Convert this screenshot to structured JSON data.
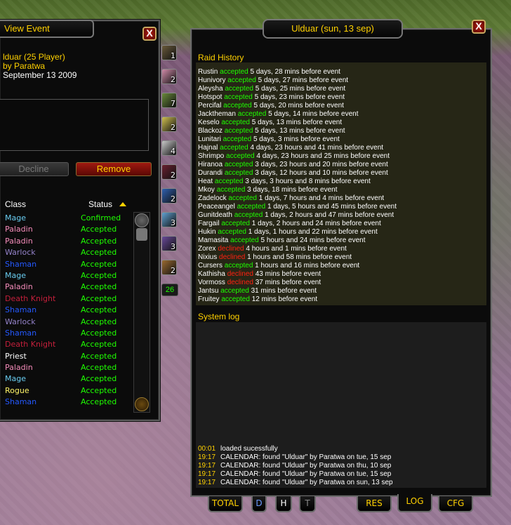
{
  "left": {
    "title": "View Event",
    "event_name": "lduar (25 Player)",
    "created_by": "by Paratwa",
    "date": "September 13 2009",
    "decline_label": "Decline",
    "remove_label": "Remove",
    "col_class": "Class",
    "col_status": "Status",
    "close_label": "X",
    "roster": [
      {
        "class": "Mage",
        "color": "#69ccf0",
        "status": "Confirmed"
      },
      {
        "class": "Paladin",
        "color": "#f58cba",
        "status": "Accepted"
      },
      {
        "class": "Paladin",
        "color": "#f58cba",
        "status": "Accepted"
      },
      {
        "class": "Warlock",
        "color": "#9482c9",
        "status": "Accepted"
      },
      {
        "class": "Shaman",
        "color": "#2459ff",
        "status": "Accepted"
      },
      {
        "class": "Mage",
        "color": "#69ccf0",
        "status": "Accepted"
      },
      {
        "class": "Paladin",
        "color": "#f58cba",
        "status": "Accepted"
      },
      {
        "class": "Death Knight",
        "color": "#c41f3b",
        "status": "Accepted"
      },
      {
        "class": "Shaman",
        "color": "#2459ff",
        "status": "Accepted"
      },
      {
        "class": "Warlock",
        "color": "#9482c9",
        "status": "Accepted"
      },
      {
        "class": "Shaman",
        "color": "#2459ff",
        "status": "Accepted"
      },
      {
        "class": "Death Knight",
        "color": "#c41f3b",
        "status": "Accepted"
      },
      {
        "class": "Priest",
        "color": "#ffffff",
        "status": "Accepted"
      },
      {
        "class": "Paladin",
        "color": "#f58cba",
        "status": "Accepted"
      },
      {
        "class": "Mage",
        "color": "#69ccf0",
        "status": "Accepted"
      },
      {
        "class": "Rogue",
        "color": "#fff569",
        "status": "Accepted"
      },
      {
        "class": "Shaman",
        "color": "#2459ff",
        "status": "Accepted"
      }
    ]
  },
  "class_counts": [
    {
      "icon": "warrior-icon",
      "count": "1"
    },
    {
      "icon": "paladin-icon",
      "count": "2"
    },
    {
      "icon": "hunter-icon",
      "count": "7"
    },
    {
      "icon": "rogue-icon",
      "count": "2"
    },
    {
      "icon": "priest-icon",
      "count": "4"
    },
    {
      "icon": "death-knight-icon",
      "count": "2"
    },
    {
      "icon": "shaman-icon",
      "count": "2"
    },
    {
      "icon": "mage-icon",
      "count": "3"
    },
    {
      "icon": "warlock-icon",
      "count": "3"
    },
    {
      "icon": "druid-icon",
      "count": "2"
    }
  ],
  "total_count": "26",
  "right": {
    "title": "Ulduar (sun, 13 sep)",
    "close_label": "X",
    "raid_history_title": "Raid History",
    "system_log_title": "System log",
    "history": [
      {
        "name": "Rustin",
        "status": "accepted",
        "when": "5 days, 28 mins before event"
      },
      {
        "name": "Hunivory",
        "status": "accepted",
        "when": "5 days, 27 mins before event"
      },
      {
        "name": "Aleysha",
        "status": "accepted",
        "when": "5 days, 25 mins before event"
      },
      {
        "name": "Hotspot",
        "status": "accepted",
        "when": "5 days, 23 mins before event"
      },
      {
        "name": "Percifal",
        "status": "accepted",
        "when": "5 days, 20 mins before event"
      },
      {
        "name": "Jacktheman",
        "status": "accepted",
        "when": "5 days, 14 mins before event"
      },
      {
        "name": "Keselo",
        "status": "accepted",
        "when": "5 days, 13 mins before event"
      },
      {
        "name": "Blackoz",
        "status": "accepted",
        "when": "5 days, 13 mins before event"
      },
      {
        "name": "Lunitari",
        "status": "accepted",
        "when": "5 days, 3 mins before event"
      },
      {
        "name": "Hajnal",
        "status": "accepted",
        "when": "4 days, 23 hours and 41 mins before event"
      },
      {
        "name": "Shrimpo",
        "status": "accepted",
        "when": "4 days, 23 hours and 25 mins before event"
      },
      {
        "name": "Hiranoa",
        "status": "accepted",
        "when": "3 days, 23 hours and 20 mins before event"
      },
      {
        "name": "Durandi",
        "status": "accepted",
        "when": "3 days, 12 hours and 10 mins before event"
      },
      {
        "name": "Heat",
        "status": "accepted",
        "when": "3 days, 3 hours and 8 mins before event"
      },
      {
        "name": "Mkoy",
        "status": "accepted",
        "when": "3 days, 18 mins before event"
      },
      {
        "name": "Zadelock",
        "status": "accepted",
        "when": "1 days, 7 hours and 4 mins before event"
      },
      {
        "name": "Peaceangel",
        "status": "accepted",
        "when": "1 days, 5 hours and 45 mins before event"
      },
      {
        "name": "Gunitdeath",
        "status": "accepted",
        "when": "1 days, 2 hours and 47 mins before event"
      },
      {
        "name": "Fargail",
        "status": "accepted",
        "when": "1 days, 2 hours and 24 mins before event"
      },
      {
        "name": "Hukin",
        "status": "accepted",
        "when": "1 days, 1 hours and 22 mins before event"
      },
      {
        "name": "Mamasita",
        "status": "accepted",
        "when": "5 hours and 24 mins before event"
      },
      {
        "name": "Zorex",
        "status": "declined",
        "when": "4 hours and 1 mins before event"
      },
      {
        "name": "Nixius",
        "status": "declined",
        "when": "1 hours and 58 mins before event"
      },
      {
        "name": "Cursers",
        "status": "accepted",
        "when": "1 hours and 16 mins before event"
      },
      {
        "name": "Kathisha",
        "status": "declined",
        "when": "43 mins before event"
      },
      {
        "name": "Vormoss",
        "status": "declined",
        "when": "37 mins before event"
      },
      {
        "name": "Jantsu",
        "status": "accepted",
        "when": "31 mins before event"
      },
      {
        "name": "Fruitey",
        "status": "accepted",
        "when": "12 mins before event"
      }
    ],
    "log": [
      {
        "time": "00:01",
        "msg": "loaded sucessfully"
      },
      {
        "time": "19:17",
        "msg": "CALENDAR: found \"Ulduar\" by Paratwa on tue, 15 sep"
      },
      {
        "time": "19:17",
        "msg": "CALENDAR: found \"Ulduar\" by Paratwa on thu, 10 sep"
      },
      {
        "time": "19:17",
        "msg": "CALENDAR: found \"Ulduar\" by Paratwa on tue, 15 sep"
      },
      {
        "time": "19:17",
        "msg": "CALENDAR: found \"Ulduar\" by Paratwa on sun, 13 sep"
      }
    ]
  },
  "tabs": {
    "total": "TOTAL",
    "d": "D",
    "h": "H",
    "t": "T",
    "res": "RES",
    "log": "LOG",
    "cfg": "CFG"
  },
  "colors": {
    "accepted": "#1eff00",
    "declined": "#ff2010",
    "gold": "#ffd100"
  }
}
